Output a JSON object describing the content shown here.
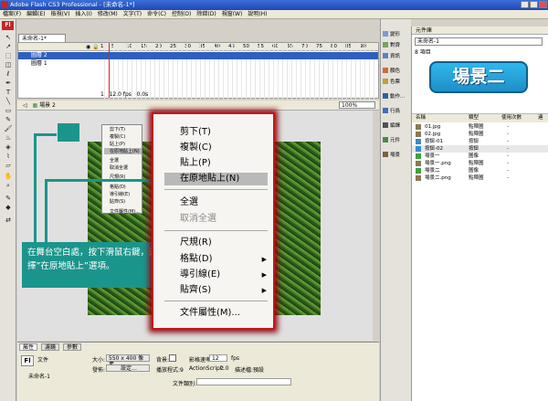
{
  "window": {
    "title": "Adobe Flash CS3 Professional - [未命名-1*]"
  },
  "menubar": [
    "檔案(F)",
    "編輯(E)",
    "檢視(V)",
    "插入(I)",
    "修改(M)",
    "文字(T)",
    "命令(C)",
    "控制(O)",
    "除錯(D)",
    "視窗(W)",
    "說明(H)"
  ],
  "doc_tab": "未命名-1*",
  "timeline": {
    "layers": [
      "圖層 2",
      "圖層 1"
    ],
    "frame_numbers": [
      "1",
      "5",
      "10",
      "15",
      "20",
      "25",
      "30",
      "35",
      "40",
      "45",
      "50",
      "55",
      "60",
      "65",
      "70",
      "75",
      "80",
      "85",
      "90"
    ],
    "status": {
      "frame": "1",
      "fps": "12.0 fps",
      "time": "0.0s"
    }
  },
  "scene": {
    "label": "場景 2",
    "zoom": "100%"
  },
  "small_menu": [
    "剪下(T)",
    "複製(C)",
    "貼上(P)",
    "在原地貼上(N)",
    "全選",
    "取消全選",
    "尺規(R)",
    "格點(D)",
    "導引線(E)",
    "貼齊(S)",
    "文件屬性(M)..."
  ],
  "big_menu": {
    "items": [
      {
        "label": "剪下(T)",
        "state": "normal"
      },
      {
        "label": "複製(C)",
        "state": "normal"
      },
      {
        "label": "貼上(P)",
        "state": "normal"
      },
      {
        "label": "在原地貼上(N)",
        "state": "highlighted"
      },
      {
        "label": "全選",
        "state": "normal"
      },
      {
        "label": "取消全選",
        "state": "disabled"
      },
      {
        "label": "尺規(R)",
        "state": "normal"
      },
      {
        "label": "格點(D)",
        "state": "normal",
        "submenu": true
      },
      {
        "label": "導引線(E)",
        "state": "normal",
        "submenu": true
      },
      {
        "label": "貼齊(S)",
        "state": "normal",
        "submenu": true
      },
      {
        "label": "文件屬性(M)...",
        "state": "normal"
      }
    ]
  },
  "callout": {
    "text": "在舞台空白處，按下滑鼠右鍵，選擇”在原地貼上”選項。"
  },
  "properties": {
    "tabs": [
      "屬性",
      "濾鏡",
      "參數"
    ],
    "type": "文件",
    "doc_name": "未命名-1",
    "size_label": "大小:",
    "size_value": "550 x 400 像素",
    "bg_label": "背景:",
    "fps_label": "影格速率:",
    "fps_value": "12",
    "fps_unit": "fps",
    "publish_label": "發佈:",
    "settings_button": "設定...",
    "player_label": "播放程式:9",
    "actionscript_label": "ActionScript:",
    "actionscript_value": "2.0",
    "profile_label": "描述檔:",
    "profile_value": "預設",
    "doc_class_label": "文件類別:"
  },
  "side_panel": [
    {
      "label": "變形",
      "color": "#7a9ad0"
    },
    {
      "label": "對齊",
      "color": "#7aa060"
    },
    {
      "label": "資訊",
      "color": "#6080c0"
    },
    {
      "label": "顏色",
      "color": "#d06a40"
    },
    {
      "label": "色票",
      "color": "#c0a030"
    },
    {
      "label": "動作...",
      "color": "#3060a0"
    },
    {
      "label": "行爲",
      "color": "#4070b0"
    },
    {
      "label": "編譯",
      "color": "#505050"
    },
    {
      "label": "元件",
      "color": "#4a8a4a"
    },
    {
      "label": "場景",
      "color": "#806040"
    }
  ],
  "library": {
    "tab": "元件庫",
    "file": "未命名-1",
    "count": "8 項目",
    "preview_text": "場景二",
    "columns": [
      "名稱",
      "類型",
      "使用次數",
      "連"
    ],
    "rows": [
      {
        "name": "01.jpg",
        "type": "點陣圖",
        "uses": "-",
        "icon": "#8a7a50",
        "selected": false
      },
      {
        "name": "02.jpg",
        "type": "點陣圖",
        "uses": "-",
        "icon": "#8a7a50",
        "selected": false
      },
      {
        "name": "按鈕-01",
        "type": "按鈕",
        "uses": "-",
        "icon": "#3a8ad0",
        "selected": false
      },
      {
        "name": "按鈕-02",
        "type": "按鈕",
        "uses": "-",
        "icon": "#3a8ad0",
        "selected": true
      },
      {
        "name": "場景一",
        "type": "圖像",
        "uses": "-",
        "icon": "#40a040",
        "selected": false
      },
      {
        "name": "場景一.png",
        "type": "點陣圖",
        "uses": "-",
        "icon": "#8a7a50",
        "selected": false
      },
      {
        "name": "場景二",
        "type": "圖像",
        "uses": "-",
        "icon": "#40a040",
        "selected": false
      },
      {
        "name": "場景二.png",
        "type": "點陣圖",
        "uses": "-",
        "icon": "#8a7a50",
        "selected": false
      }
    ]
  },
  "colors": {
    "accent": "#1b958b",
    "menu_border": "#c8151b",
    "flash_red": "#c4262a"
  }
}
